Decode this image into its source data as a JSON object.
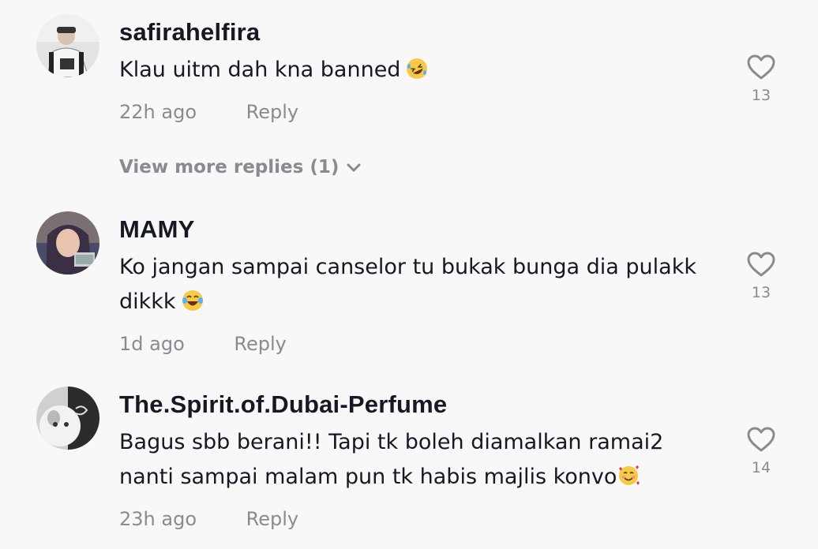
{
  "comments": [
    {
      "username": "safirahelfira",
      "text": "Klau uitm dah kna banned",
      "emoji": "rolling-on-floor-laughing",
      "time": "22h ago",
      "reply_label": "Reply",
      "like_count": "13",
      "view_more": "View more replies (1)"
    },
    {
      "username": "MAMY",
      "text_line1": "Ko jangan sampai canselor tu bukak bunga dia pulakk",
      "text_line2": "dikkk",
      "emoji": "face-with-tears-of-joy",
      "time": "1d ago",
      "reply_label": "Reply",
      "like_count": "13"
    },
    {
      "username": "The.Spirit.of.Dubai-Perfume",
      "text_line1": "Bagus sbb berani!! Tapi tk boleh diamalkan ramai2",
      "text_line2": "nanti sampai malam pun tk habis majlis konvo",
      "emoji": "smiling-face-with-hearts",
      "time": "23h ago",
      "reply_label": "Reply",
      "like_count": "14"
    }
  ],
  "colors": {
    "background": "#f8f8f8",
    "primary_text": "#161823",
    "secondary_text": "#8a8b91"
  }
}
